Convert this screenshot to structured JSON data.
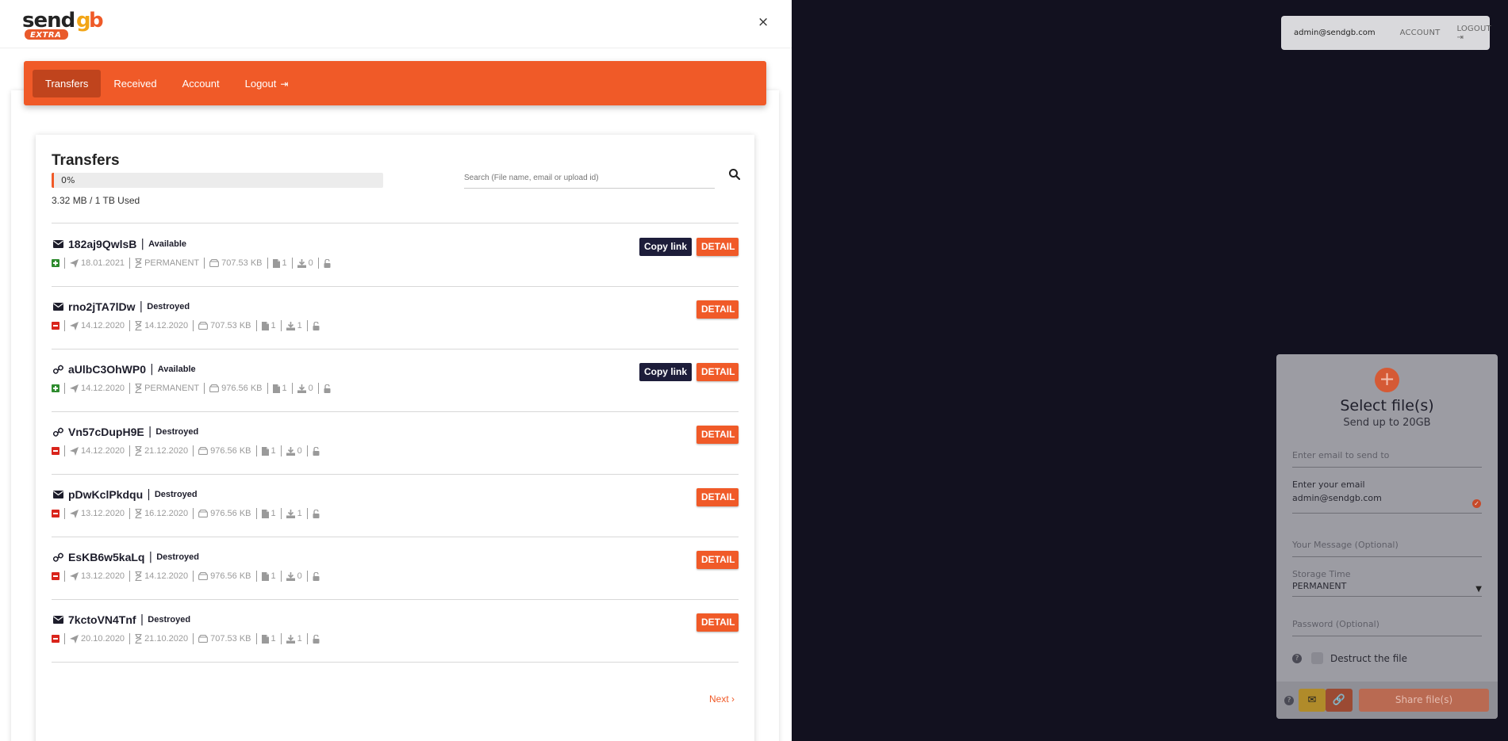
{
  "top_bar": {
    "email": "admin@sendgb.com",
    "account": "ACCOUNT",
    "logout": "LOGOUT"
  },
  "upload": {
    "title": "Select file(s)",
    "subtitle": "Send up to 20GB",
    "email_to_placeholder": "Enter email to send to",
    "your_email_label": "Enter your email",
    "your_email_value": "admin@sendgb.com",
    "message_placeholder": "Your Message (Optional)",
    "storage_label": "Storage Time",
    "storage_value": "PERMANENT",
    "password_placeholder": "Password (Optional)",
    "destruct_label": "Destruct the file",
    "share_button": "Share file(s)"
  },
  "header": {
    "logo_word": "sendgb",
    "logo_badge": "EXTRA",
    "close": "×"
  },
  "nav": {
    "items": [
      {
        "label": "Transfers"
      },
      {
        "label": "Received"
      },
      {
        "label": "Account"
      },
      {
        "label": "Logout"
      }
    ]
  },
  "transfers": {
    "title": "Transfers",
    "usage_percent": "0%",
    "usage_text": "3.32 MB / 1 TB Used",
    "search_placeholder": "Search (File name, email or upload id)",
    "copy_label": "Copy link",
    "detail_label": "DETAIL",
    "next_label": "Next",
    "rows": [
      {
        "code": "182aj9QwlsB",
        "type": "email",
        "status": "Available",
        "sent": "18.01.2021",
        "expires": "PERMANENT",
        "size": "707.53 KB",
        "files": "1",
        "downloads": "0",
        "has_copy": true,
        "state": "plus"
      },
      {
        "code": "rno2jTA7lDw",
        "type": "email",
        "status": "Destroyed",
        "sent": "14.12.2020",
        "expires": "14.12.2020",
        "size": "707.53 KB",
        "files": "1",
        "downloads": "1",
        "has_copy": false,
        "state": "minus"
      },
      {
        "code": "aUlbC3OhWP0",
        "type": "link",
        "status": "Available",
        "sent": "14.12.2020",
        "expires": "PERMANENT",
        "size": "976.56 KB",
        "files": "1",
        "downloads": "0",
        "has_copy": true,
        "state": "plus"
      },
      {
        "code": "Vn57cDupH9E",
        "type": "link",
        "status": "Destroyed",
        "sent": "14.12.2020",
        "expires": "21.12.2020",
        "size": "976.56 KB",
        "files": "1",
        "downloads": "0",
        "has_copy": false,
        "state": "minus"
      },
      {
        "code": "pDwKclPkdqu",
        "type": "email",
        "status": "Destroyed",
        "sent": "13.12.2020",
        "expires": "16.12.2020",
        "size": "976.56 KB",
        "files": "1",
        "downloads": "1",
        "has_copy": false,
        "state": "minus"
      },
      {
        "code": "EsKB6w5kaLq",
        "type": "link",
        "status": "Destroyed",
        "sent": "13.12.2020",
        "expires": "14.12.2020",
        "size": "976.56 KB",
        "files": "1",
        "downloads": "0",
        "has_copy": false,
        "state": "minus"
      },
      {
        "code": "7kctoVN4Tnf",
        "type": "email",
        "status": "Destroyed",
        "sent": "20.10.2020",
        "expires": "21.10.2020",
        "size": "707.53 KB",
        "files": "1",
        "downloads": "1",
        "has_copy": false,
        "state": "minus"
      }
    ]
  },
  "colors": {
    "brand": "#f05a28",
    "dark": "#1d1d3a",
    "background": "#12111f"
  }
}
